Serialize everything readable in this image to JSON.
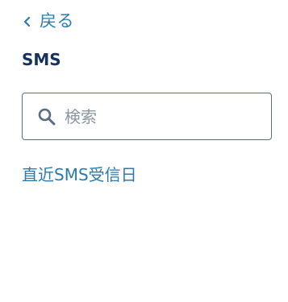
{
  "nav": {
    "back_label": "戻る"
  },
  "header": {
    "title": "SMS"
  },
  "search": {
    "placeholder": "検索",
    "value": ""
  },
  "list": {
    "items": [
      {
        "label": "直近SMS受信日"
      }
    ]
  },
  "colors": {
    "link": "#2a7ab0",
    "title": "#16325c",
    "border": "#5a6e82",
    "placeholder": "#8a96a3"
  }
}
